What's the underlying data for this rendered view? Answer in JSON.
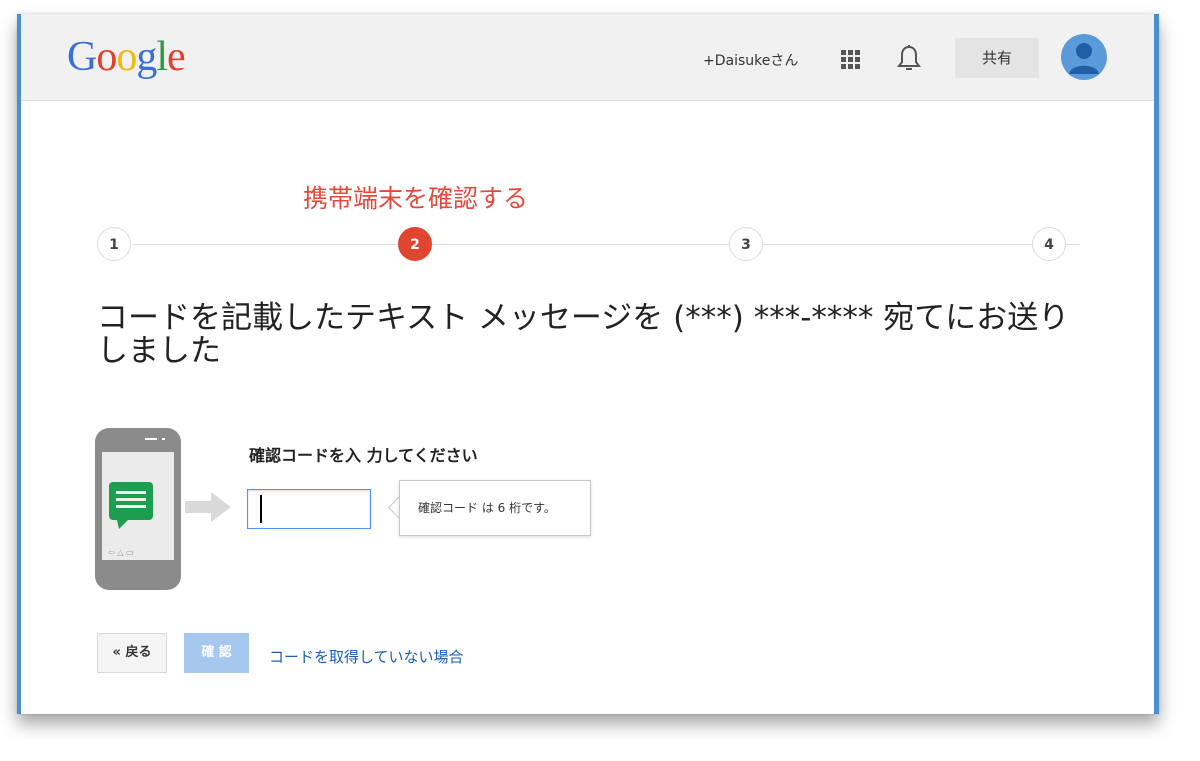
{
  "header": {
    "logo_letters": [
      {
        "ch": "G",
        "color": "#3a6fd8"
      },
      {
        "ch": "o",
        "color": "#e0402e"
      },
      {
        "ch": "o",
        "color": "#f2b90f"
      },
      {
        "ch": "g",
        "color": "#3a6fd8"
      },
      {
        "ch": "l",
        "color": "#2b9a47"
      },
      {
        "ch": "e",
        "color": "#e0402e"
      }
    ],
    "user_link": "+Daisukeさん",
    "apps_icon": "apps-grid-icon",
    "notifications_icon": "bell-icon",
    "share_label": "共有",
    "avatar_icon": "user-avatar-icon"
  },
  "stepper": {
    "title": "携帯端末を確認する",
    "active_step": 2,
    "steps": [
      "1",
      "2",
      "3",
      "4"
    ],
    "active_color": "#e0462f"
  },
  "main": {
    "headline": "コードを記載したテキスト メッセージを (***) ***-**** 宛てにお送りしました",
    "phone_icon": "phone-sms-icon",
    "arrow_icon": "arrow-right-icon",
    "code_label": "確認コードを入 力してください",
    "code_value": "",
    "tooltip": "確認コード は 6 桁です。"
  },
  "actions": {
    "back_label": "« 戻る",
    "confirm_label": "確 認",
    "no_code_link": "コードを取得していない場合"
  }
}
